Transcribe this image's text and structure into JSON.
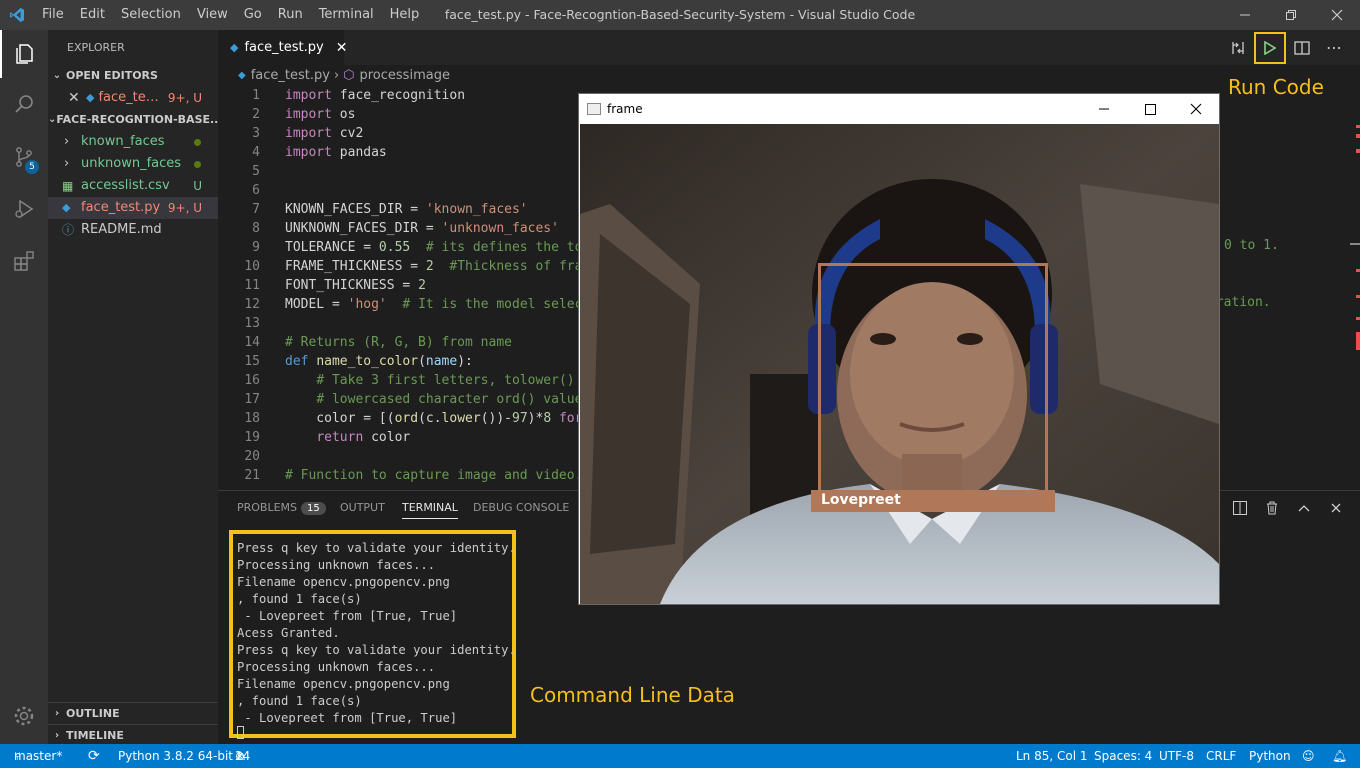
{
  "titlebar": {
    "title": "face_test.py - Face-Recogntion-Based-Security-System - Visual Studio Code",
    "menu": [
      "File",
      "Edit",
      "Selection",
      "View",
      "Go",
      "Run",
      "Terminal",
      "Help"
    ]
  },
  "activity": {
    "scm_badge": "5"
  },
  "sidebar": {
    "header": "EXPLORER",
    "open_editors_title": "OPEN EDITORS",
    "open_editor": {
      "name": "face_test.py",
      "deco": "9+, U"
    },
    "folder_title": "FACE-RECOGNTION-BASE...",
    "items": [
      {
        "name": "known_faces"
      },
      {
        "name": "unknown_faces"
      },
      {
        "name": "accesslist.csv",
        "deco": "U"
      },
      {
        "name": "face_test.py",
        "deco": "9+, U"
      },
      {
        "name": "README.md"
      }
    ],
    "outline_title": "OUTLINE",
    "timeline_title": "TIMELINE"
  },
  "editor": {
    "tab_label": "face_test.py",
    "breadcrumb": {
      "file": "face_test.py",
      "symbol": "processimage"
    },
    "line_numbers": [
      "1",
      "2",
      "3",
      "4",
      "5",
      "6",
      "7",
      "8",
      "9",
      "10",
      "11",
      "12",
      "13",
      "14",
      "15",
      "16",
      "17",
      "18",
      "19",
      "20",
      "21"
    ],
    "right_text": {
      "line9": "0 to 1.",
      "line12": "eration."
    }
  },
  "panel": {
    "tabs": {
      "problems": "PROBLEMS",
      "problems_count": "15",
      "output": "OUTPUT",
      "terminal": "TERMINAL",
      "debug": "DEBUG CONSOLE"
    },
    "terminal_lines": [
      "Press q key to validate your identity.",
      "Processing unknown faces...",
      "Filename opencv.pngopencv.png",
      ", found 1 face(s)",
      " - Lovepreet from [True, True]",
      "Acess Granted.",
      "Press q key to validate your identity.",
      "Processing unknown faces...",
      "Filename opencv.pngopencv.png",
      ", found 1 face(s)",
      " - Lovepreet from [True, True]"
    ]
  },
  "annotations": {
    "run_code": "Run Code",
    "command_line": "Command Line Data"
  },
  "frame_window": {
    "title": "frame",
    "face_label": "Lovepreet"
  },
  "statusbar": {
    "branch": "master*",
    "python": "Python 3.8.2 64-bit",
    "errors": "14",
    "warnings": "1",
    "position": "Ln 85, Col 1",
    "spaces": "Spaces: 4",
    "encoding": "UTF-8",
    "eol": "CRLF",
    "language": "Python"
  },
  "colors": {
    "accent": "#007acc",
    "highlight": "#f5bf1c",
    "face_box": "#b07858"
  }
}
